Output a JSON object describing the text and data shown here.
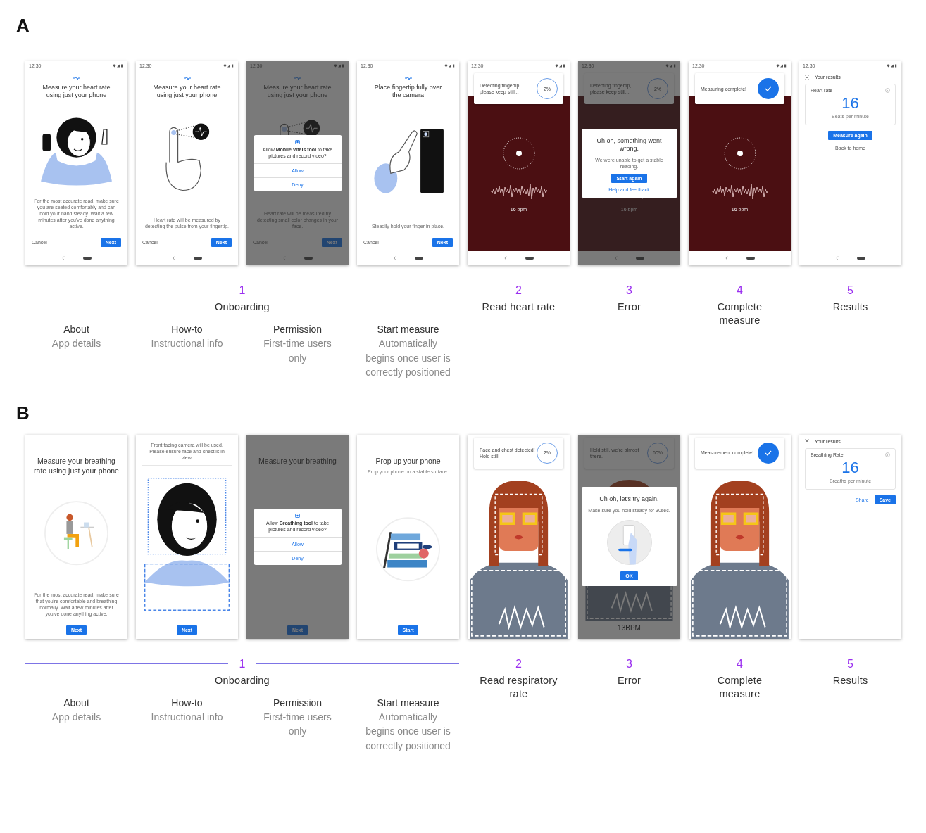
{
  "panels": [
    {
      "label": "A",
      "screens": [
        {
          "kind": "onboarding",
          "status_time": "12:30",
          "logo": true,
          "title": "Measure your heart rate using just your phone",
          "illustration": {
            "kind": "woman-phone"
          },
          "body": "For the most accurate read, make sure you are seated comfortably and can hold your hand steady. Wait a few minutes after you've done anything active.",
          "cancel": "Cancel",
          "next": "Next",
          "nav_bar": true,
          "dimmed": false
        },
        {
          "kind": "onboarding",
          "status_time": "12:30",
          "logo": true,
          "title": "Measure your heart rate using just your phone",
          "illustration": {
            "kind": "finger-pulse"
          },
          "body": "Heart rate will be measured by detecting the pulse from your fingertip.",
          "cancel": "Cancel",
          "next": "Next",
          "nav_bar": true,
          "dimmed": false
        },
        {
          "kind": "onboarding",
          "status_time": "12:30",
          "logo": true,
          "title": "Measure your heart rate using just your phone",
          "illustration": {
            "kind": "finger-pulse"
          },
          "body": "Heart rate will be measured by detecting small color changes in your face.",
          "cancel": "Cancel",
          "next": "Next",
          "nav_bar": true,
          "dimmed": true,
          "dialog": {
            "kind": "permission",
            "text": "Allow **Mobile Vitals tool** to take pictures and record video?",
            "allow": "Allow",
            "deny": "Deny"
          }
        },
        {
          "kind": "onboarding",
          "status_time": "12:30",
          "logo": true,
          "title": "Place fingertip fully over the camera",
          "illustration": {
            "kind": "finger-camera"
          },
          "body": "Steadily hold your finger in place.",
          "cancel": "Cancel",
          "next": "Next",
          "nav_bar": true,
          "dimmed": false
        },
        {
          "kind": "measure",
          "status_time": "12:30",
          "card": {
            "kind": "progress",
            "text": "Detecting fingertip, please keep still...",
            "percent": "2%"
          },
          "scene": {
            "kind": "pulse"
          },
          "reading": "16 bpm",
          "nav_bar": true,
          "dimmed": false
        },
        {
          "kind": "measure",
          "status_time": "12:30",
          "card": {
            "kind": "progress",
            "text": "Detecting fingertip, please keep still...",
            "percent": "2%"
          },
          "scene": {
            "kind": "pulse"
          },
          "reading": "16 bpm",
          "nav_bar": true,
          "dimmed": true,
          "dialog": {
            "kind": "error",
            "title": "Uh oh, something went wrong.",
            "message": "We were unable to get a stable reading.",
            "button": "Start again",
            "link": "Help and feedback"
          }
        },
        {
          "kind": "measure",
          "status_time": "12:30",
          "card": {
            "kind": "done",
            "text": "Measuring complete!"
          },
          "scene": {
            "kind": "pulse"
          },
          "reading": "16 bpm",
          "nav_bar": true,
          "dimmed": false
        },
        {
          "kind": "results",
          "status_time": "12:30",
          "title": "Your results",
          "card": {
            "label": "Heart rate",
            "value": "16",
            "unit": "Beats per minute"
          },
          "actions": {
            "kind": "stack",
            "items": [
              {
                "kind": "primary",
                "label": "Measure again"
              },
              {
                "kind": "text",
                "label": "Back to home"
              }
            ]
          },
          "nav_bar": true,
          "dimmed": false
        }
      ],
      "stages": [
        {
          "number": "1",
          "title": "Onboarding",
          "steps": [
            {
              "title": "About",
              "description": "App details"
            },
            {
              "title": "How-to",
              "description": "Instructional info"
            },
            {
              "title": "Permission",
              "description": "First-time users only"
            },
            {
              "title": "Start measure",
              "description": "Automatically begins once user is correctly positioned"
            }
          ]
        },
        {
          "number": "2",
          "title": "Read heart rate"
        },
        {
          "number": "3",
          "title": "Error"
        },
        {
          "number": "4",
          "title": "Complete measure"
        },
        {
          "number": "5",
          "title": "Results"
        }
      ]
    },
    {
      "label": "B",
      "screens": [
        {
          "kind": "onboarding",
          "logo": false,
          "title": "Measure your breathing rate using just your phone",
          "illustration": {
            "kind": "person-desk"
          },
          "body": "For the most accurate read, make sure that you're comfortable and breathing normally. Wait a few minutes after you've done anything active.",
          "next": "Next",
          "nav_bar": false,
          "dimmed": false
        },
        {
          "kind": "onboarding",
          "logo": false,
          "top_note": "Front facing camera will be used. Please ensure face and chest is in view.",
          "illustration": {
            "kind": "face-frame"
          },
          "next": "Next",
          "nav_bar": false,
          "dimmed": false
        },
        {
          "kind": "onboarding",
          "logo": false,
          "title": "Measure your breathing",
          "next": "Next",
          "nav_bar": false,
          "dimmed": true,
          "dialog": {
            "kind": "permission",
            "text": "Allow **Breathing tool** to take pictures and record video?",
            "allow": "Allow",
            "deny": "Deny"
          }
        },
        {
          "kind": "onboarding",
          "logo": false,
          "title": "Prop up your phone",
          "subtitle": "Prop your phone on a stable surface.",
          "illustration": {
            "kind": "books"
          },
          "next": "Start",
          "nav_bar": false,
          "dimmed": false
        },
        {
          "kind": "measure",
          "card": {
            "kind": "progress",
            "text": "Face and chest detected! Hold still",
            "percent": "2%"
          },
          "scene": {
            "kind": "face"
          },
          "nav_bar": false,
          "dimmed": false
        },
        {
          "kind": "measure",
          "card": {
            "kind": "progress",
            "text": "Hold still, we're almost there.",
            "percent": "60%"
          },
          "scene": {
            "kind": "face"
          },
          "reading": "13BPM",
          "nav_bar": false,
          "dimmed": true,
          "dialog": {
            "kind": "error",
            "title": "Uh oh, let's try again.",
            "message": "Make sure you hold steady for 30sec.",
            "illustration": {
              "kind": "hold-phone"
            },
            "button": "OK"
          }
        },
        {
          "kind": "measure",
          "card": {
            "kind": "done",
            "text": "Measurement complete!"
          },
          "scene": {
            "kind": "face"
          },
          "nav_bar": false,
          "dimmed": false
        },
        {
          "kind": "results",
          "title": "Your results",
          "card": {
            "label": "Breathing Rate",
            "value": "16",
            "unit": "Breaths per minute"
          },
          "actions": {
            "kind": "row",
            "items": [
              {
                "kind": "text",
                "label": "Share"
              },
              {
                "kind": "primary",
                "label": "Save"
              }
            ]
          },
          "nav_bar": false,
          "dimmed": false
        }
      ],
      "stages": [
        {
          "number": "1",
          "title": "Onboarding",
          "steps": [
            {
              "title": "About",
              "description": "App details"
            },
            {
              "title": "How-to",
              "description": "Instructional info"
            },
            {
              "title": "Permission",
              "description": "First-time users only"
            },
            {
              "title": "Start measure",
              "description": "Automatically begins once user is correctly positioned"
            }
          ]
        },
        {
          "number": "2",
          "title": "Read respiratory rate"
        },
        {
          "number": "3",
          "title": "Error"
        },
        {
          "number": "4",
          "title": "Complete measure"
        },
        {
          "number": "5",
          "title": "Results"
        }
      ]
    }
  ]
}
